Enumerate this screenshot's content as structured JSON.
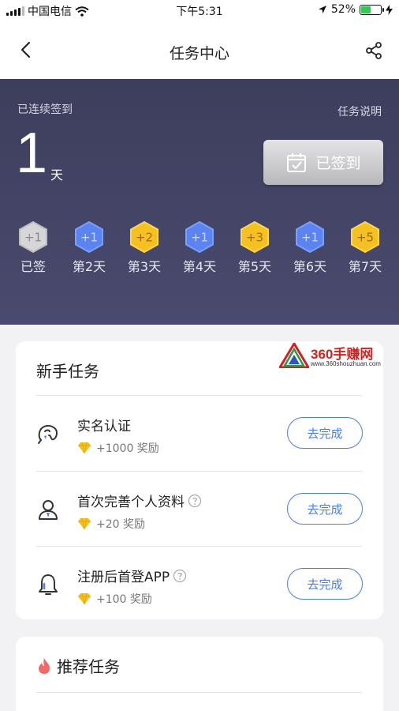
{
  "status_bar": {
    "carrier": "中国电信",
    "time": "下午5:31",
    "battery_text": "52%",
    "battery_level": 0.52,
    "wifi_icon": "wifi-icon",
    "location_icon": "location-arrow-icon",
    "charging_icon": "bolt-icon"
  },
  "nav": {
    "title": "任务中心",
    "back_icon": "chevron-left-icon",
    "share_icon": "share-icon"
  },
  "hero": {
    "streak_label": "已连续签到",
    "info_link": "任务说明",
    "streak_days": "1",
    "streak_unit": "天",
    "signed_button": "已签到",
    "days": [
      {
        "badge": "+1",
        "label": "已签",
        "state": "done"
      },
      {
        "badge": "+1",
        "label": "第2天",
        "state": "blue"
      },
      {
        "badge": "+2",
        "label": "第3天",
        "state": "gold"
      },
      {
        "badge": "+1",
        "label": "第4天",
        "state": "blue"
      },
      {
        "badge": "+3",
        "label": "第5天",
        "state": "gold"
      },
      {
        "badge": "+1",
        "label": "第6天",
        "state": "blue"
      },
      {
        "badge": "+5",
        "label": "第7天",
        "state": "gold"
      }
    ]
  },
  "newbie": {
    "title": "新手任务",
    "tasks": [
      {
        "name": "实名认证",
        "reward": "+1000 奖励",
        "button": "去完成",
        "icon": "id-verify-icon",
        "has_help": false
      },
      {
        "name": "首次完善个人资料",
        "reward": "+20 奖励",
        "button": "去完成",
        "icon": "profile-icon",
        "has_help": true
      },
      {
        "name": "注册后首登APP",
        "reward": "+100 奖励",
        "button": "去完成",
        "icon": "bell-icon",
        "has_help": true
      }
    ]
  },
  "recommended": {
    "title": "推荐任务",
    "icon": "flame-icon"
  },
  "watermark": {
    "name": "360手赚网",
    "url": "www.360shouzhuan.com"
  },
  "colors": {
    "accent": "#4a7df0",
    "hero_bg": "#414162",
    "gold": "#f5c022",
    "blue_badge": "#5b84f0",
    "flame": "#f06a6a"
  }
}
